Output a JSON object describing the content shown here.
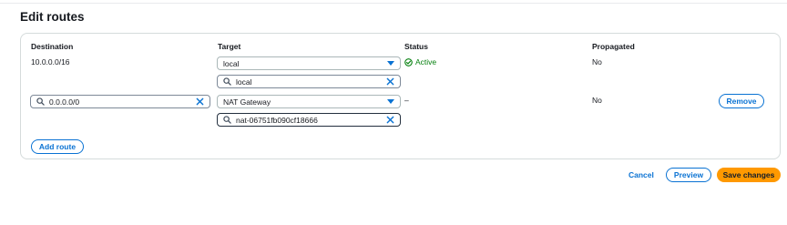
{
  "page": {
    "title": "Edit routes"
  },
  "table": {
    "headers": {
      "destination": "Destination",
      "target": "Target",
      "status": "Status",
      "propagated": "Propagated"
    },
    "rows": [
      {
        "destination": "10.0.0.0/16",
        "target_selected": "local",
        "target_filter": "local",
        "status": "Active",
        "propagated": "No"
      },
      {
        "destination_input": "0.0.0.0/0",
        "target_selected": "NAT Gateway",
        "target_filter": "nat-06751fb090cf18666",
        "status": "–",
        "propagated": "No",
        "remove_label": "Remove"
      }
    ],
    "add_route_label": "Add route"
  },
  "footer": {
    "cancel_label": "Cancel",
    "preview_label": "Preview",
    "save_label": "Save changes"
  },
  "icons": {
    "search": "search-icon",
    "clear": "close-icon",
    "caret": "caret-down-icon",
    "status_ok": "check-circle-icon"
  },
  "colors": {
    "link_blue": "#0972d3",
    "primary_orange": "#ff9900",
    "success_green": "#037f0c"
  }
}
